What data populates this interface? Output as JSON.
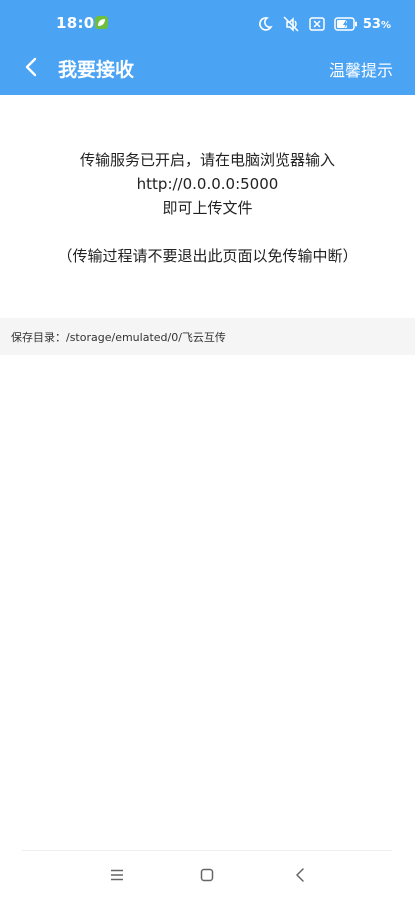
{
  "status_bar": {
    "time": "18:04",
    "battery": "53",
    "battery_unit": "%",
    "icons": [
      "leaf-icon",
      "moon-icon",
      "mute-icon",
      "no-sim-icon",
      "battery-icon"
    ]
  },
  "app_bar": {
    "title": "我要接收",
    "tips_label": "温馨提示",
    "back_icon": "chevron-left-icon"
  },
  "main": {
    "line1": "传输服务已开启，请在电脑浏览器输入",
    "url": "http://0.0.0.0:5000",
    "line3": "即可上传文件",
    "note": "（传输过程请不要退出此页面以免传输中断）",
    "save_dir_label": "保存目录：",
    "save_dir_path": "/storage/emulated/0/飞云互传"
  },
  "nav_bar": {
    "icons": [
      "menu-icon",
      "home-icon",
      "back-icon"
    ]
  },
  "colors": {
    "header": "#4aa3f3",
    "save_dir_bg": "#f5f5f5",
    "text": "#222222"
  }
}
